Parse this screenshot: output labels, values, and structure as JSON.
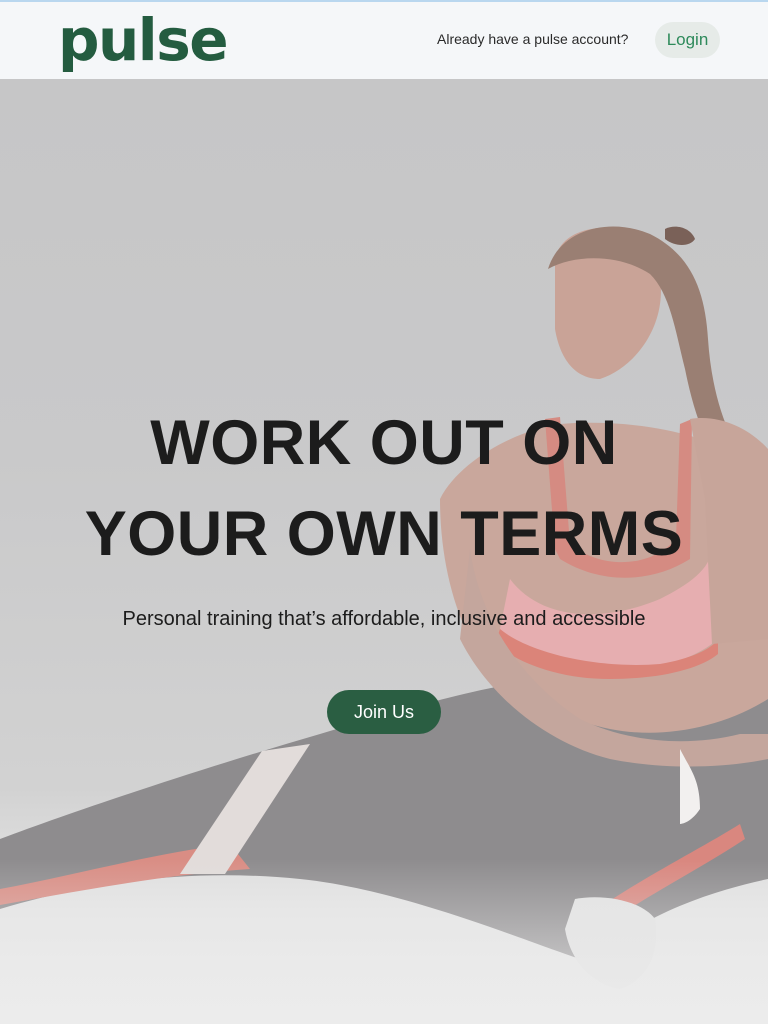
{
  "header": {
    "logo_text": "pulse",
    "account_prompt": "Already have a pulse account?",
    "login_label": "Login"
  },
  "hero": {
    "headline_line1": "WORK OUT ON",
    "headline_line2": "YOUR OWN TERMS",
    "subheadline": "Personal training that’s affordable, inclusive and accessible",
    "cta_label": "Join Us"
  },
  "colors": {
    "brand_green": "#245c40",
    "cta_green": "#2a5e42",
    "login_text_green": "#2e8a5b",
    "header_bg": "#f5f7f9"
  }
}
